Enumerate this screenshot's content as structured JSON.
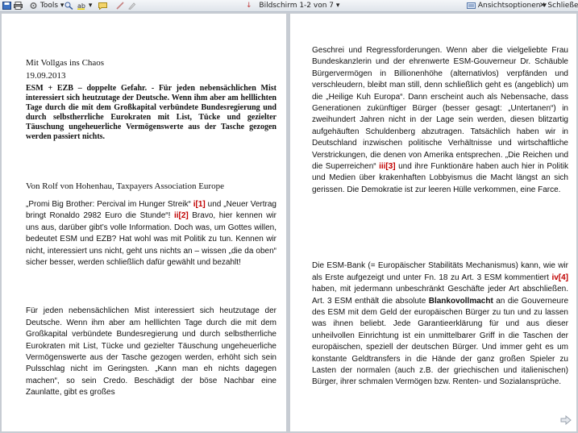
{
  "toolbar": {
    "tools_label": "Tools",
    "pager_label": "Bildschirm 1-2 von 7",
    "view_options_label": "Ansichtsoptionen",
    "close_label": "Schließen"
  },
  "left": {
    "title": "Mit Vollgas ins Chaos",
    "date": "19.09.2013",
    "lead": "ESM + EZB – doppelte Gefahr. - Für jeden nebensächlichen Mist interessiert sich heutzutage der Deutsche. Wenn ihm aber am helllichten Tage durch die mit dem Großkapital verbündete Bundesregierung und durch selbstherrliche Eurokraten mit List, Tücke und gezielter Täuschung ungeheuerliche Vermögenswerte aus der Tasche gezogen werden passiert nichts.",
    "author": "Von Rolf von Hohenhau,  Taxpayers Association Europe",
    "p1_a": "„Promi Big Brother: Percival im Hunger Streik“ ",
    "p1_ref1": "i[1]",
    "p1_b": " und „Neuer Vertrag bringt Ronaldo 2982 Euro die Stunde“! ",
    "p1_ref2": "ii[2]",
    "p1_c": " Bravo, hier kennen wir uns aus, darüber gibt’s volle Information. Doch was, um Gottes willen, bedeutet ESM und EZB? Hat wohl was mit Politik zu tun. Kennen wir nicht, interessiert uns nicht, geht uns nichts an – wissen „die da oben“ sicher besser,  werden schließlich dafür gewählt und bezahlt!",
    "p2": "Für jeden nebensächlichen Mist interessiert sich heutzutage der Deutsche. Wenn ihm aber am helllichten Tage  durch die mit dem Großkapital verbündete Bundesregierung und durch selbstherrliche Eurokraten mit List, Tücke und gezielter Täuschung ungeheuerliche Vermögenswerte aus der Tasche gezogen werden, erhöht sich sein Pulsschlag nicht im Geringsten. „Kann man eh nichts dagegen machen“, so sein Credo. Beschädigt der böse Nachbar eine Zaunlatte, gibt es großes"
  },
  "right": {
    "p1_a": "Geschrei und Regressforderungen. Wenn aber die vielgeliebte Frau Bundeskanzlerin und der ehrenwerte ESM-Gouverneur Dr. Schäuble Bürgervermögen in Billionenhöhe (alternativlos) verpfänden und  verschleudern, bleibt man still, denn schließlich geht es (angeblich) um die „Heilige Kuh Europa“. Dann erscheint auch als Nebensache,   dass Generationen zukünftiger Bürger (besser gesagt: „Untertanen“) in zweihundert Jahren nicht in der Lage sein werden, diesen blitzartig aufgehäuften Schuldenberg abzutragen. Tatsächlich  haben wir in Deutschland inzwischen politische Verhältnisse und wirtschaftliche Verstrickungen, die denen von Amerika entsprechen. „Die Reichen und die Superreichen“ ",
    "p1_ref": "iii[3]",
    "p1_b": " und ihre Funktionäre haben auch hier in Politik und Medien über krakenhaften Lobbyismus die Macht längst an sich gerissen. Die Demokratie ist zur leeren Hülle verkommen, eine Farce.",
    "p2_a": "Die ESM-Bank (= Europäischer Stabilitäts Mechanismus) kann, wie wir als Erste aufgezeigt und unter Fn. 18 zu Art. 3 ESM kommentiert  ",
    "p2_ref": "iv[4]",
    "p2_b": "  haben,     mit jedermann unbeschränkt Geschäfte jeder Art abschließen.  Art. 3 ESM enthält die absolute ",
    "p2_bold": "Blankovollmacht",
    "p2_c": " an die Gouverneure des ESM mit dem Geld der europäischen Bürger zu tun und zu lassen was ihnen beliebt. Jede Garantieerklärung für und aus dieser unheilvollen Einrichtung ist ein unmittelbarer Griff in die Taschen der europäischen, speziell der deutschen Bürger. Und immer geht es um konstante Geldtransfers in die Hände der ganz großen Spieler zu Lasten der normalen (auch z.B. der griechischen und italienischen)  Bürger, ihrer schmalen Vermögen bzw. Renten- und Sozialansprüche."
  }
}
